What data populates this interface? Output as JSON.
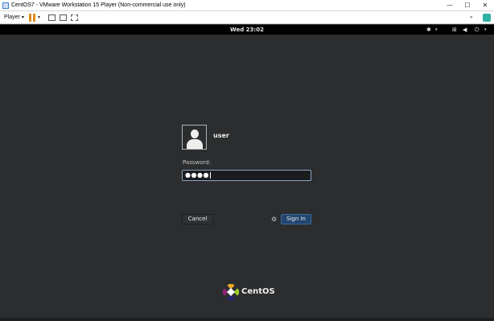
{
  "window": {
    "title": "CentOS7 - VMware Workstation 15 Player (Non-commercial use only)",
    "controls": {
      "minimize": "—",
      "maximize": "☐",
      "close": "✕"
    }
  },
  "toolbar": {
    "player_menu": "Player",
    "menu_caret": "▾",
    "pause_caret": "▾",
    "back_label": "«"
  },
  "gnome_panel": {
    "clock": "Wed 23:02",
    "accessibility_glyph": "✱",
    "network_glyph": "⊞",
    "volume_glyph": "◀",
    "power_glyph": "⏻",
    "caret": "▾"
  },
  "login": {
    "username": "user",
    "password_label": "Password:",
    "password_value": "●●●●",
    "cancel_label": "Cancel",
    "signin_label": "Sign In",
    "gear_glyph": "⚙"
  },
  "branding": {
    "text": "CentOS",
    "colors": [
      "#efa724",
      "#9ccd2a",
      "#262577",
      "#932279"
    ]
  }
}
